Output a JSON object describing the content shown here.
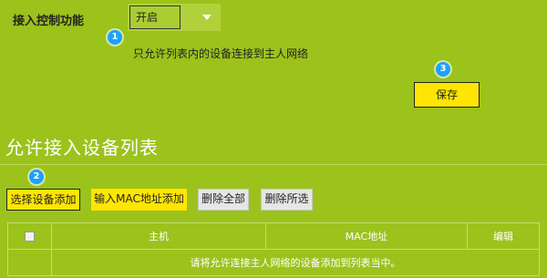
{
  "access_control": {
    "label": "接入控制功能",
    "selected": "开启",
    "hint": "只允许列表内的设备连接到主人网络"
  },
  "steps": [
    "1",
    "2",
    "3"
  ],
  "save_label": "保存",
  "section_title": "允许接入设备列表",
  "toolbar": {
    "select_add": "选择设备添加",
    "mac_add": "输入MAC地址添加",
    "delete_all": "删除全部",
    "delete_selected": "删除所选"
  },
  "table": {
    "headers": [
      "主机",
      "MAC地址",
      "编辑"
    ],
    "empty_message": "请将允许连接主人网络的设备添加到列表当中。"
  },
  "icons": {
    "dropdown": "chevron-down-icon",
    "checkbox": "checkbox-icon"
  },
  "colors": {
    "background": "#9cc21c",
    "button_yellow": "#ffe600",
    "step_badge": "#1ea0ff",
    "secondary_button": "#e6e6e6"
  }
}
